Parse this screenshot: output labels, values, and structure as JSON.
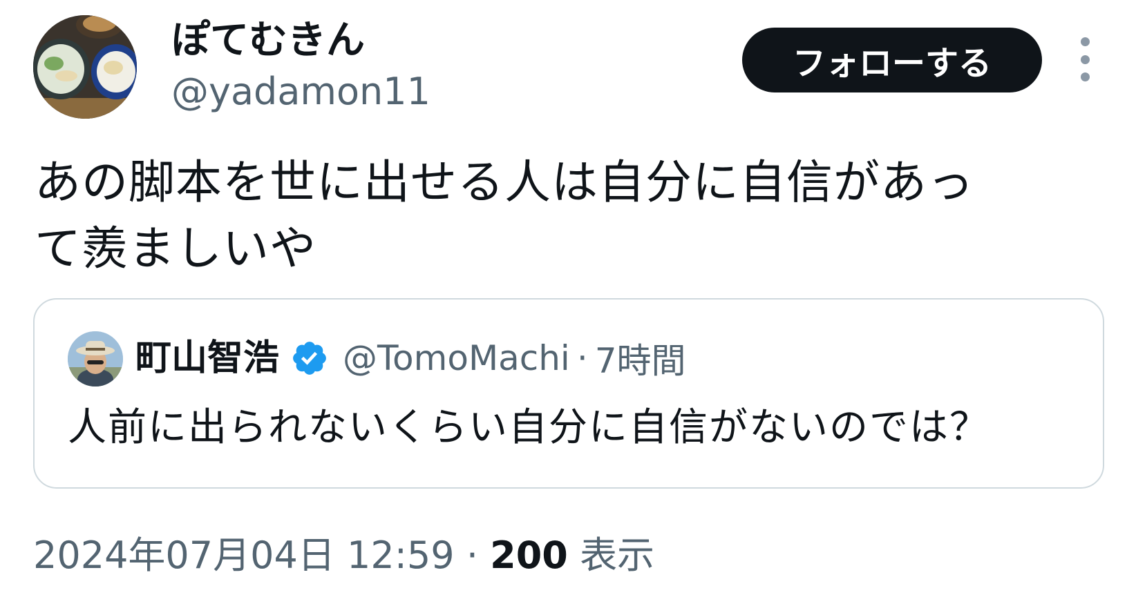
{
  "author": {
    "display_name": "ぽてむきん",
    "handle": "@yadamon11",
    "avatar_icon": "food-plates-avatar"
  },
  "actions": {
    "follow_label": "フォローする",
    "more_icon": "more-vertical-icon"
  },
  "tweet": {
    "text_line1": "あの脚本を世に出せる人は自分に自信があっ",
    "text_line2": "て羨ましいや"
  },
  "quote": {
    "display_name": "町山智浩",
    "verified_icon": "verified-badge-icon",
    "handle": "@TomoMachi",
    "separator": "·",
    "time": "7時間",
    "text": "人前に出られないくらい自分に自信がないのでは？"
  },
  "meta": {
    "datetime": "2024年07月04日 12:59",
    "separator": "·",
    "views_count": "200",
    "views_label": "表示"
  },
  "colors": {
    "text": "#0f1419",
    "secondary": "#536471",
    "verified": "#1d9bf0",
    "border": "#cfd9de",
    "follow_bg": "#0f1419"
  }
}
